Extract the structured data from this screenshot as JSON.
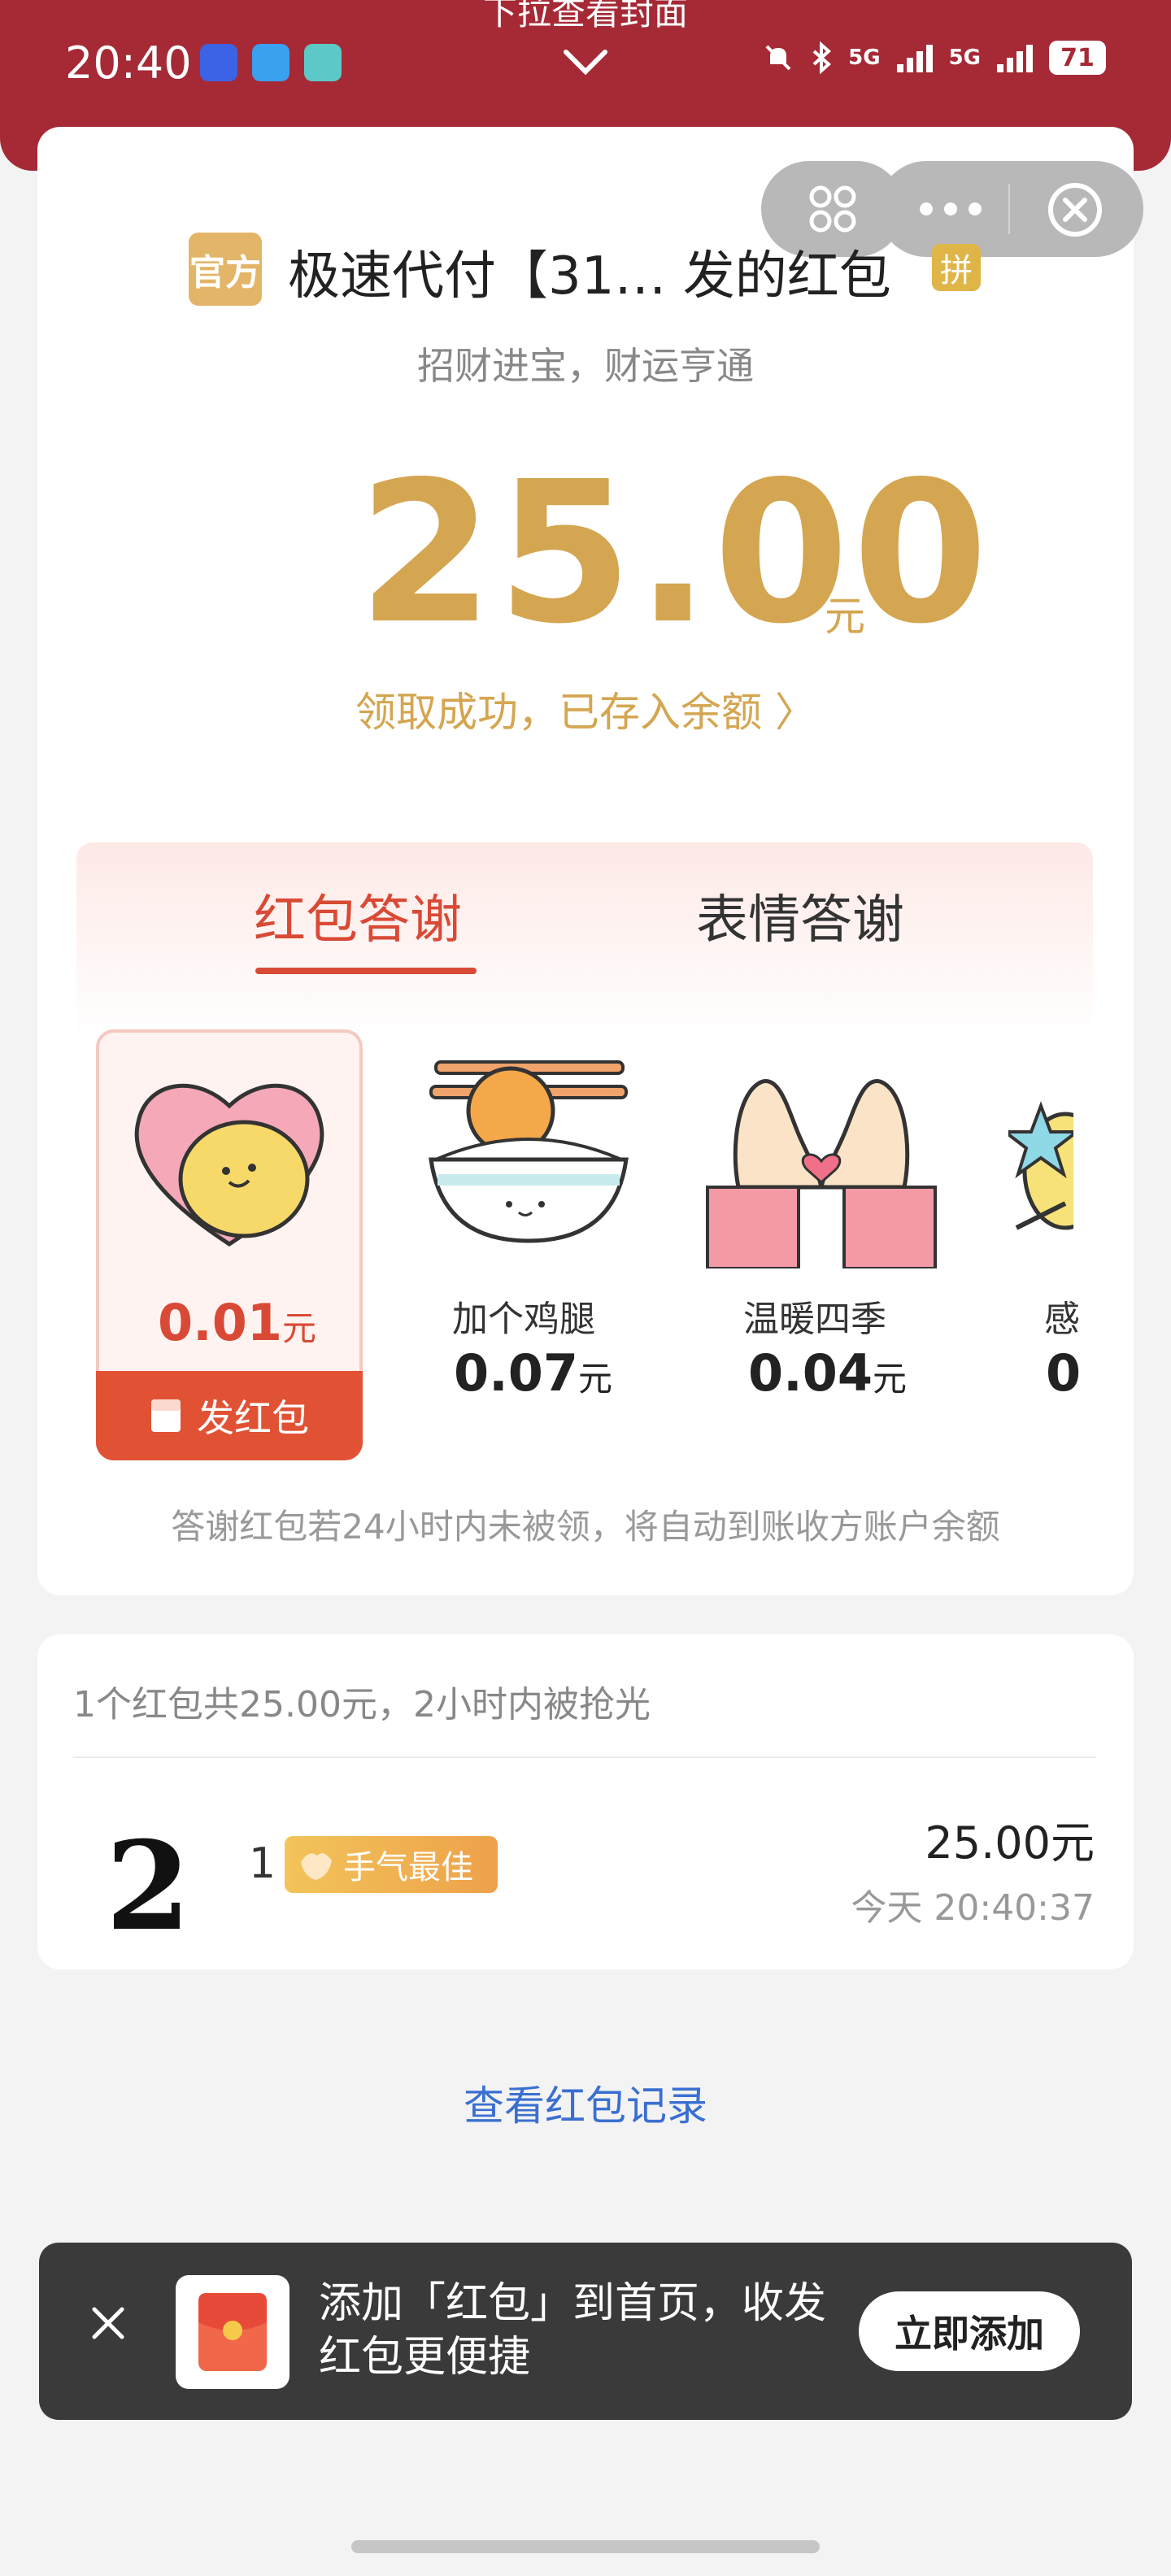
{
  "status_bar": {
    "time": "20:40",
    "network_1": "5G",
    "network_2": "5G",
    "battery": "71"
  },
  "pull_hint": "下拉查看封面",
  "header": {
    "official_badge": "官方",
    "title": "极速代付【31… 发的红包",
    "group_badge": "拼",
    "greeting": "招财进宝，财运亨通"
  },
  "amount": {
    "value": "25.00",
    "unit": "元",
    "status": "领取成功，已存入余额 〉"
  },
  "thanks": {
    "tabs": [
      {
        "label": "红包答谢"
      },
      {
        "label": "表情答谢"
      }
    ],
    "gifts": [
      {
        "name": "",
        "price": "0.01",
        "unit": "元"
      },
      {
        "name": "加个鸡腿",
        "price": "0.07",
        "unit": "元"
      },
      {
        "name": "温暖四季",
        "price": "0.04",
        "unit": "元"
      },
      {
        "name": "感",
        "price": "0",
        "unit": ""
      }
    ],
    "send_button": "发红包",
    "note": "答谢红包若24小时内未被领，将自动到账收方账户余额"
  },
  "summary": {
    "text": "1个红包共25.00元，2小时内被抢光",
    "record": {
      "rank": "2",
      "name": "1",
      "badge": "手气最佳",
      "amount": "25.00元",
      "time": "今天 20:40:37"
    }
  },
  "records_link": "查看红包记录",
  "toast": {
    "text": "添加「红包」到首页，收发红包更便捷",
    "button": "立即添加"
  },
  "colors": {
    "header_red": "#a52a36",
    "gold": "#d4a651",
    "accent_red": "#e15234",
    "link_blue": "#3a6fd1"
  }
}
